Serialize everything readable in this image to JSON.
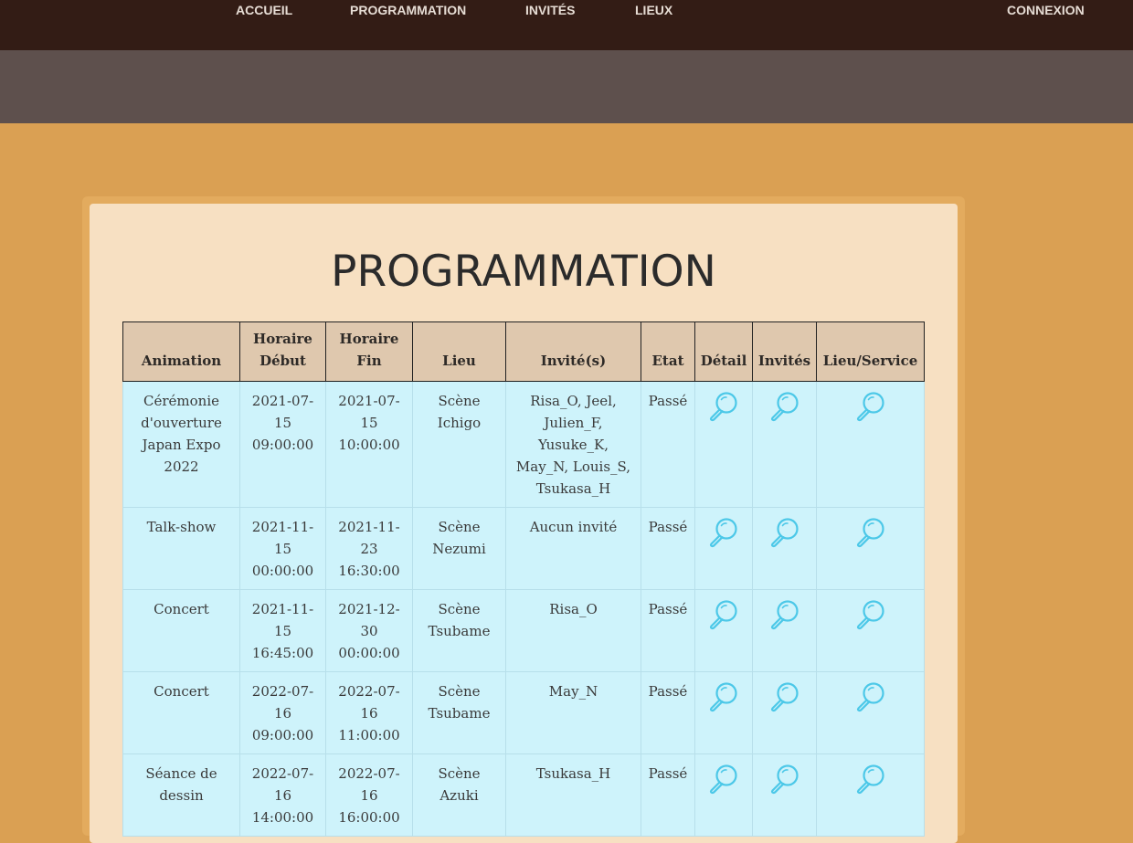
{
  "nav": {
    "items": [
      {
        "label": "ACCUEIL"
      },
      {
        "label": "PROGRAMMATION"
      },
      {
        "label": "INVITÉS"
      },
      {
        "label": "LIEUX"
      }
    ],
    "login": "CONNEXION"
  },
  "page": {
    "title": "PROGRAMMATION"
  },
  "colors": {
    "nav_bg": "#331c15",
    "banner_bg": "#5e504d",
    "page_bg": "#daa053",
    "card_bg": "#f7e0c2",
    "header_bg": "#dfc8ae",
    "row_bg": "#cef3fb",
    "icon_color": "#4cc8e8"
  },
  "table": {
    "headers": [
      "Animation",
      "Horaire Début",
      "Horaire Fin",
      "Lieu",
      "Invité(s)",
      "Etat",
      "Détail",
      "Invités",
      "Lieu/Service"
    ],
    "rows": [
      {
        "animation": "Cérémonie d'ouverture Japan Expo 2022",
        "debut": "2021-07-15 09:00:00",
        "fin": "2021-07-15 10:00:00",
        "lieu": "Scène Ichigo",
        "invites": "Risa_O, Jeel, Julien_F, Yusuke_K, May_N, Louis_S, Tsukasa_H",
        "etat": "Passé"
      },
      {
        "animation": "Talk-show",
        "debut": "2021-11-15 00:00:00",
        "fin": "2021-11-23 16:30:00",
        "lieu": "Scène Nezumi",
        "invites": "Aucun invité",
        "etat": "Passé"
      },
      {
        "animation": "Concert",
        "debut": "2021-11-15 16:45:00",
        "fin": "2021-12-30 00:00:00",
        "lieu": "Scène Tsubame",
        "invites": "Risa_O",
        "etat": "Passé"
      },
      {
        "animation": "Concert",
        "debut": "2022-07-16 09:00:00",
        "fin": "2022-07-16 11:00:00",
        "lieu": "Scène Tsubame",
        "invites": "May_N",
        "etat": "Passé"
      },
      {
        "animation": "Séance de dessin",
        "debut": "2022-07-16 14:00:00",
        "fin": "2022-07-16 16:00:00",
        "lieu": "Scène Azuki",
        "invites": "Tsukasa_H",
        "etat": "Passé"
      }
    ],
    "action_icon": "magnifier-icon"
  }
}
